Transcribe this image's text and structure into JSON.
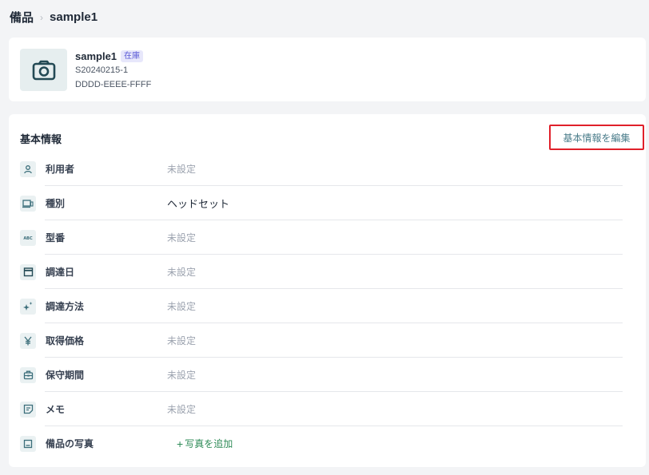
{
  "breadcrumb": {
    "root": "備品",
    "separator": "›",
    "current": "sample1"
  },
  "asset": {
    "icon": "camera-icon",
    "name": "sample1",
    "status_badge": "在庫",
    "code": "S20240215-1",
    "serial": "DDDD-EEEE-FFFF"
  },
  "info": {
    "title": "基本情報",
    "edit_label": "基本情報を編集",
    "rows": [
      {
        "icon": "user-icon",
        "label": "利用者",
        "value": "未設定"
      },
      {
        "icon": "device-icon",
        "label": "種別",
        "value": "ヘッドセット"
      },
      {
        "icon": "model-number-icon",
        "label": "型番",
        "value": "未設定"
      },
      {
        "icon": "calendar-icon",
        "label": "調達日",
        "value": "未設定"
      },
      {
        "icon": "sparkle-icon",
        "label": "調達方法",
        "value": "未設定"
      },
      {
        "icon": "yen-icon",
        "label": "取得価格",
        "value": "未設定"
      },
      {
        "icon": "toolbox-icon",
        "label": "保守期間",
        "value": "未設定"
      },
      {
        "icon": "memo-icon",
        "label": "メモ",
        "value": "未設定"
      },
      {
        "icon": "image-icon",
        "label": "備品の写真",
        "add_label": "写真を追加"
      }
    ]
  },
  "colors": {
    "accent_green": "#2e8b57",
    "edit_text": "#4a7c8a",
    "highlight_border": "#e0202a",
    "badge_text": "#5b5bd6",
    "badge_bg": "#e7e7fb"
  }
}
